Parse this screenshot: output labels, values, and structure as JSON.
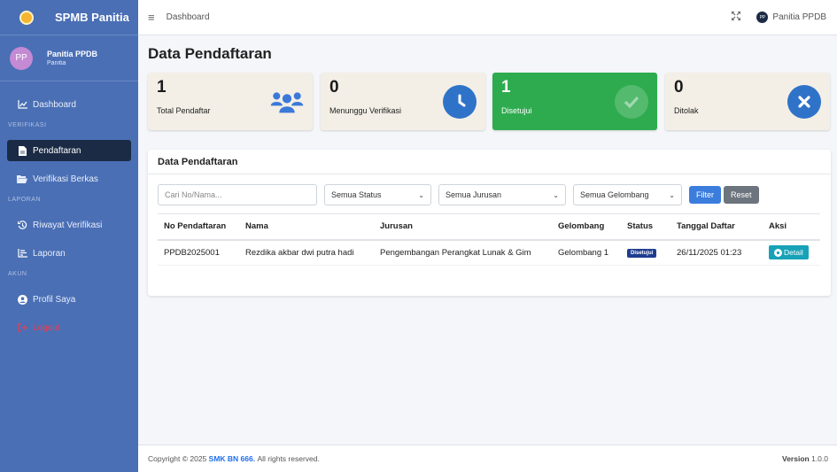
{
  "sidebar": {
    "brand": "SPMB Panitia",
    "user_initials": "PP",
    "user_name": "Panitia PPDB",
    "user_role": "Panitia",
    "items": {
      "dashboard": "Dashboard",
      "header_verifikasi": "VERIFIKASI",
      "pendaftaran": "Pendaftaran",
      "verifikasi_berkas": "Verifikasi Berkas",
      "header_laporan": "LAPORAN",
      "riwayat": "Riwayat Verifikasi",
      "laporan": "Laporan",
      "header_akun": "AKUN",
      "profil": "Profil Saya",
      "logout": "Logout"
    }
  },
  "topbar": {
    "breadcrumb": "Dashboard",
    "user_initials": "PP",
    "user_name": "Panitia PPDB"
  },
  "page": {
    "title": "Data Pendaftaran"
  },
  "stats": [
    {
      "value": "1",
      "label": "Total Pendaftar",
      "icon": "users-icon",
      "color": "#3b78d8"
    },
    {
      "value": "0",
      "label": "Menunggu Verifikasi",
      "icon": "clock-icon",
      "color": "#2f73c9"
    },
    {
      "value": "1",
      "label": "Disetujui",
      "icon": "check-circle-icon",
      "color": "#2eab4f"
    },
    {
      "value": "0",
      "label": "Ditolak",
      "icon": "times-circle-icon",
      "color": "#2f73c9"
    }
  ],
  "card": {
    "title": "Data Pendaftaran",
    "filters": {
      "search_placeholder": "Cari No/Nama...",
      "status_selected": "Semua Status",
      "jurusan_selected": "Semua Jurusan",
      "gelombang_selected": "Semua Gelombang",
      "filter_label": "Filter",
      "reset_label": "Reset"
    },
    "table": {
      "headers": [
        "No Pendaftaran",
        "Nama",
        "Jurusan",
        "Gelombang",
        "Status",
        "Tanggal Daftar",
        "Aksi"
      ],
      "rows": [
        {
          "no": "PPDB2025001",
          "nama": "Rezdika akbar dwi putra hadi",
          "jurusan": "Pengembangan Perangkat Lunak & Gim",
          "gelombang": "Gelombang 1",
          "status": "Disetujui",
          "tanggal": "26/11/2025 01:23",
          "aksi": "Detail"
        }
      ]
    }
  },
  "footer": {
    "copyright_prefix": "Copyright © 2025",
    "school": "SMK BN 666.",
    "rights": "All rights reserved.",
    "version_label": "Version",
    "version": "1.0.0"
  }
}
